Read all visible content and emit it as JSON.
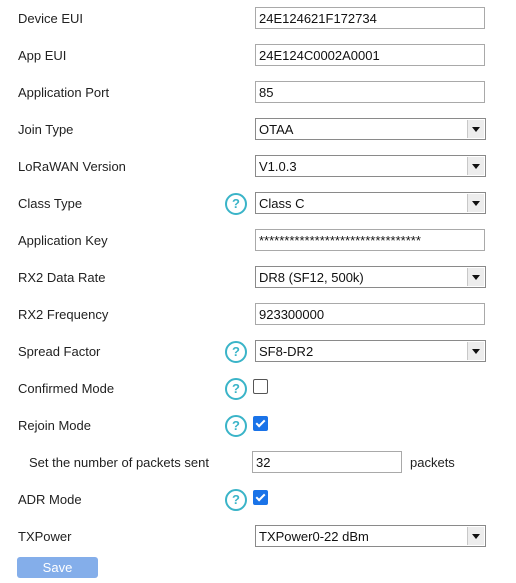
{
  "form": {
    "device_eui": {
      "label": "Device EUI",
      "value": "24E124621F172734"
    },
    "app_eui": {
      "label": "App EUI",
      "value": "24E124C0002A0001"
    },
    "application_port": {
      "label": "Application Port",
      "value": "85"
    },
    "join_type": {
      "label": "Join Type",
      "value": "OTAA"
    },
    "lorawan_version": {
      "label": "LoRaWAN Version",
      "value": "V1.0.3"
    },
    "class_type": {
      "label": "Class Type",
      "value": "Class C"
    },
    "application_key": {
      "label": "Application Key",
      "value": "********************************"
    },
    "rx2_data_rate": {
      "label": "RX2 Data Rate",
      "value": "DR8 (SF12, 500k)"
    },
    "rx2_frequency": {
      "label": "RX2 Frequency",
      "value": "923300000"
    },
    "spread_factor": {
      "label": "Spread Factor",
      "value": "SF8-DR2"
    },
    "confirmed_mode": {
      "label": "Confirmed Mode",
      "checked": false
    },
    "rejoin_mode": {
      "label": "Rejoin Mode",
      "checked": true
    },
    "packets_sent": {
      "label": "Set the number of packets sent",
      "value": "32",
      "unit": "packets"
    },
    "adr_mode": {
      "label": "ADR Mode",
      "checked": true
    },
    "txpower": {
      "label": "TXPower",
      "value": "TXPower0-22 dBm"
    },
    "help_glyph": "?",
    "save_label": "Save"
  },
  "colors": {
    "help_icon": "#3ab4c8",
    "checkbox_checked": "#1a73e8",
    "save_button": "#84aeea"
  }
}
